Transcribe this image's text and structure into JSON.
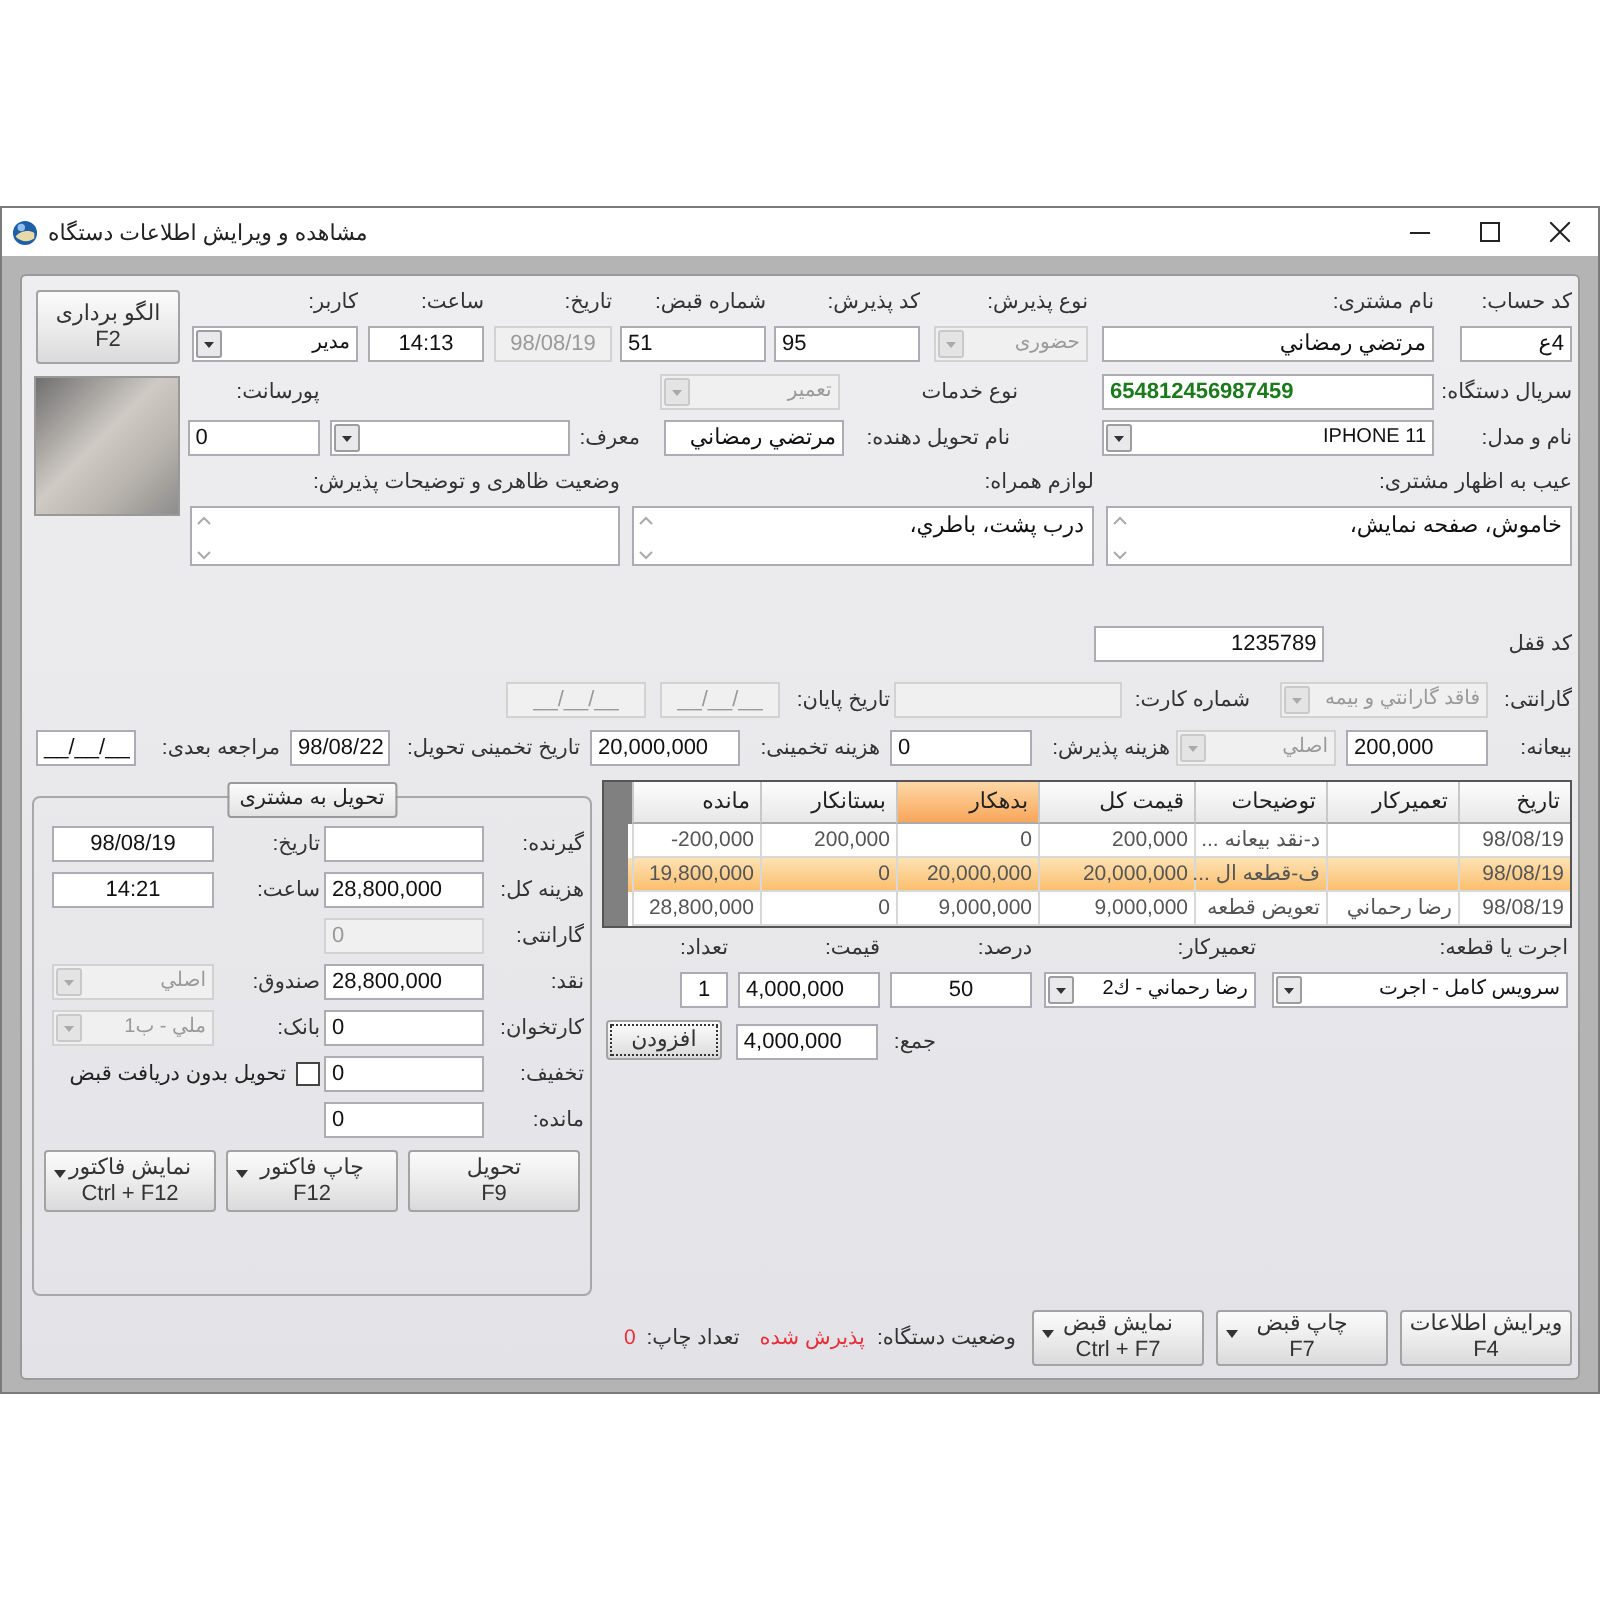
{
  "window": {
    "title": "مشاهده و ویرایش اطلاعات دستگاه"
  },
  "template_button": {
    "label": "الگو برداری",
    "shortcut": "F2"
  },
  "top_rows": [
    [
      {
        "kind": "input",
        "caption": "کد حساب:",
        "value": "4ع",
        "disabled": false
      },
      {
        "kind": "input",
        "caption": "نام مشتری:",
        "value": "مرتضي رمضاني",
        "disabled": false
      },
      {
        "kind": "select",
        "caption": "نوع پذیرش:",
        "value": "حضوری",
        "disabled": true
      },
      {
        "kind": "input",
        "caption": "کد پذیرش:",
        "value": "95",
        "disabled": false
      },
      {
        "kind": "input",
        "caption": "شماره قبض:",
        "value": "51",
        "disabled": false
      },
      {
        "kind": "input",
        "caption": "تاریخ:",
        "value": "98/08/19",
        "disabled": true
      },
      {
        "kind": "input",
        "caption": "ساعت:",
        "value": "14:13",
        "disabled": false
      },
      {
        "kind": "select",
        "caption": "کاربر:",
        "value": "مدیر",
        "disabled": false
      }
    ],
    [
      {
        "kind": "label",
        "text": "سریال دستگاه:"
      },
      {
        "kind": "input",
        "value": "654812456987459",
        "disabled": false,
        "highlight": true
      },
      {
        "kind": "label",
        "text": "نوع خدمات"
      },
      {
        "kind": "select",
        "value": "تعمیر",
        "disabled": true
      },
      {
        "kind": "label",
        "text": "پورسانت:"
      }
    ],
    [
      {
        "kind": "label",
        "text": "نام و مدل:"
      },
      {
        "kind": "select",
        "value": "IPHONE 11",
        "disabled": false
      },
      {
        "kind": "label",
        "text": "نام تحویل دهنده:"
      },
      {
        "kind": "input",
        "value": "مرتضي رمضاني",
        "disabled": false
      },
      {
        "kind": "label",
        "text": "معرف:"
      },
      {
        "kind": "select",
        "disabled": false
      },
      {
        "kind": "input",
        "value": "0",
        "disabled": false
      }
    ],
    [
      {
        "kind": "textarea",
        "caption": "عیب به اظهار مشتری:",
        "value": "خاموش، صفحه نمایش،",
        "disabled": false
      },
      {
        "kind": "textarea",
        "caption": "لوازم همراه:",
        "value": "درب پشت، باطري،",
        "disabled": false
      },
      {
        "kind": "textarea",
        "caption": "وضعیت ظاهری و توضیحات پذیرش:",
        "disabled": false
      }
    ]
  ],
  "mid_rows": [
    [
      {
        "kind": "label",
        "text": "کد قفل"
      },
      {
        "kind": "input",
        "value": "1235789",
        "disabled": false
      }
    ],
    [
      {
        "kind": "label",
        "text": "گارانتی:"
      },
      {
        "kind": "select",
        "value": "فاقد گارانتي و بيمه",
        "disabled": true
      },
      {
        "kind": "label",
        "text": "شماره کارت:"
      },
      {
        "kind": "input",
        "disabled": true
      },
      {
        "kind": "label",
        "text": "تاریخ پایان:"
      },
      {
        "kind": "input",
        "value": "__/__/__",
        "disabled": true
      },
      {
        "kind": "input",
        "value": "__/__/__",
        "disabled": true
      }
    ],
    [
      {
        "kind": "label",
        "text": "بیعانه:"
      },
      {
        "kind": "input",
        "value": "200,000",
        "disabled": false
      },
      {
        "kind": "select",
        "value": "اصلي",
        "disabled": true
      },
      {
        "kind": "label",
        "text": "هزینه پذیرش:"
      },
      {
        "kind": "input",
        "value": "0",
        "disabled": false
      },
      {
        "kind": "label",
        "text": "هزینه تخمینی:"
      },
      {
        "kind": "input",
        "value": "20,000,000",
        "disabled": false
      },
      {
        "kind": "label",
        "text": "تاریخ تخمینی تحویل:"
      },
      {
        "kind": "input",
        "value": "98/08/22",
        "disabled": false
      },
      {
        "kind": "label",
        "text": "مراجعه بعدی:"
      },
      {
        "kind": "input",
        "value": "__/__/__",
        "disabled": false
      }
    ]
  ],
  "grid": {
    "columns": [
      {
        "label": "تاریخ",
        "sorted": false
      },
      {
        "label": "تعمیرکار",
        "sorted": false
      },
      {
        "label": "توضیحات",
        "sorted": false
      },
      {
        "label": "قیمت کل",
        "sorted": false
      },
      {
        "label": "بدهکار",
        "sorted": true
      },
      {
        "label": "بستانکار",
        "sorted": false
      },
      {
        "label": "مانده",
        "sorted": false
      }
    ],
    "rows": [
      {
        "selected": false,
        "date": "98/08/19",
        "description": "د-نقد بيعانه ...",
        "total": "200,000",
        "debit": "0",
        "credit": "200,000",
        "balance": "-200,000"
      },
      {
        "selected": true,
        "date": "98/08/19",
        "description": "ف-قطعه ال ...",
        "total": "20,000,000",
        "debit": "20,000,000",
        "credit": "0",
        "balance": "19,800,000"
      },
      {
        "selected": false,
        "date": "98/08/19",
        "technician": "رضا رحماني",
        "description": "تعويض قطعه",
        "total": "9,000,000",
        "debit": "9,000,000",
        "credit": "0",
        "balance": "28,800,000"
      }
    ]
  },
  "entry_rows": [
    [
      {
        "kind": "select",
        "caption": "اجرت یا قطعه:",
        "value": "سرويس كامل - اجرت",
        "disabled": false
      },
      {
        "kind": "select",
        "caption": "تعمیرکار:",
        "value": "رضا رحماني - ك2",
        "disabled": false
      },
      {
        "kind": "input",
        "caption": "درصد:",
        "value": "50",
        "disabled": false
      },
      {
        "kind": "input",
        "caption": "قیمت:",
        "value": "4,000,000",
        "disabled": false
      },
      {
        "kind": "input",
        "caption": "تعداد:",
        "value": "1",
        "disabled": false
      }
    ],
    [
      {
        "kind": "label",
        "text": "جمع:"
      },
      {
        "kind": "input",
        "value": "4,000,000",
        "disabled": false
      },
      {
        "kind": "button",
        "label": "افزودن",
        "focused": true
      }
    ]
  ],
  "actions": [
    {
      "kind": "button",
      "label": "ویرایش اطلاعات",
      "shortcut": "F4",
      "menu": false
    },
    {
      "kind": "button",
      "label": "چاپ قبض",
      "shortcut": "F7",
      "menu": true
    },
    {
      "kind": "button",
      "label": "نمایش قبض",
      "shortcut": "Ctrl + F7",
      "menu": true
    },
    {
      "kind": "label",
      "text": "وضعیت دستگاه:"
    },
    {
      "kind": "status",
      "text": "پذیرش شده",
      "color": "#e8303a"
    },
    {
      "kind": "label",
      "text": "تعداد چاپ:"
    },
    {
      "kind": "status",
      "text": "0",
      "color": "#e8303a"
    }
  ],
  "delivery": {
    "title": "تحویل به مشتری",
    "rows": [
      [
        {
          "kind": "label",
          "text": "گیرنده:"
        },
        {
          "kind": "input",
          "disabled": false
        },
        {
          "kind": "label",
          "text": "تاریخ:"
        },
        {
          "kind": "input",
          "value": "98/08/19",
          "disabled": false
        }
      ],
      [
        {
          "kind": "label",
          "text": "هزینه کل:"
        },
        {
          "kind": "input",
          "value": "28,800,000",
          "disabled": false
        },
        {
          "kind": "label",
          "text": "ساعت:"
        },
        {
          "kind": "input",
          "value": "14:21",
          "disabled": false
        }
      ],
      [
        {
          "kind": "label",
          "text": "گارانتی:"
        },
        {
          "kind": "input",
          "value": "0",
          "disabled": true
        }
      ],
      [
        {
          "kind": "label",
          "text": "نقد:"
        },
        {
          "kind": "input",
          "value": "28,800,000",
          "disabled": false
        },
        {
          "kind": "label",
          "text": "صندوق:"
        },
        {
          "kind": "select",
          "value": "اصلي",
          "disabled": true
        }
      ],
      [
        {
          "kind": "label",
          "text": "کارتخوان:"
        },
        {
          "kind": "input",
          "value": "0",
          "disabled": false
        },
        {
          "kind": "label",
          "text": "بانک:"
        },
        {
          "kind": "select",
          "value": "ملي - ب1",
          "disabled": true
        }
      ],
      [
        {
          "kind": "label",
          "text": "تخفیف:"
        },
        {
          "kind": "input",
          "value": "0",
          "disabled": false
        },
        {
          "kind": "checkbox",
          "text": "تحویل بدون دریافت قبض",
          "checked": false
        }
      ],
      [
        {
          "kind": "label",
          "text": "مانده:"
        },
        {
          "kind": "input",
          "value": "0",
          "disabled": false
        }
      ]
    ],
    "buttons": [
      {
        "kind": "button",
        "label": "تحویل",
        "shortcut": "F9",
        "menu": false
      },
      {
        "kind": "button",
        "label": "چاپ فاکتور",
        "shortcut": "F12",
        "menu": true
      },
      {
        "kind": "button",
        "label": "نمایش فاکتور",
        "shortcut": "Ctrl + F12",
        "menu": true
      }
    ]
  }
}
